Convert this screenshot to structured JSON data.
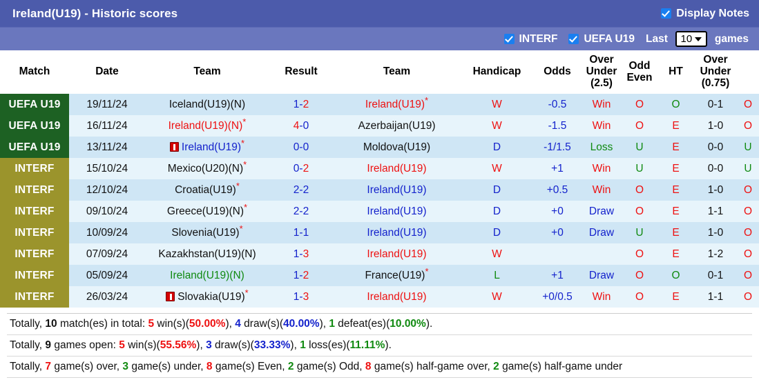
{
  "header": {
    "title": "Ireland(U19) - Historic scores",
    "display_notes_label": "Display Notes",
    "display_notes_checked": true,
    "filters": [
      {
        "label": "INTERF",
        "checked": true
      },
      {
        "label": "UEFA U19",
        "checked": true
      }
    ],
    "last_label": "Last",
    "games_label": "games",
    "games_count": "10"
  },
  "table": {
    "columns": [
      "Match",
      "Date",
      "Team",
      "Result",
      "Team",
      "Handicap",
      "Odds",
      "Over Under (2.5)",
      "Odd Even",
      "HT",
      "Over Under (0.75)"
    ],
    "columns_multiline": {
      "ou25": [
        "Over",
        "Under",
        "(2.5)"
      ],
      "oddeven": [
        "Odd",
        "Even"
      ],
      "ou075": [
        "Over",
        "Under",
        "(0.75)"
      ]
    },
    "rows": [
      {
        "league": "UEFA U19",
        "league_type": "uefa",
        "date": "19/11/24",
        "team1": "Iceland(U19)(N)",
        "team1_color": "black",
        "team1_star": false,
        "team1_card": false,
        "score_home": "1",
        "score_away": "2",
        "score_home_color": "blue",
        "score_away_color": "red",
        "team2": "Ireland(U19)",
        "team2_color": "red",
        "team2_star": true,
        "team2_card": false,
        "result": "W",
        "result_color": "red",
        "handicap": "-0.5",
        "odds": "Win",
        "odds_color": "red",
        "ou25": "O",
        "ou25_color": "red",
        "oddeven": "O",
        "oddeven_color": "green",
        "ht": "0-1",
        "ou075": "O",
        "ou075_color": "red"
      },
      {
        "league": "UEFA U19",
        "league_type": "uefa",
        "date": "16/11/24",
        "team1": "Ireland(U19)(N)",
        "team1_color": "red",
        "team1_star": true,
        "team1_card": false,
        "score_home": "4",
        "score_away": "0",
        "score_home_color": "red",
        "score_away_color": "blue",
        "team2": "Azerbaijan(U19)",
        "team2_color": "black",
        "team2_star": false,
        "team2_card": false,
        "result": "W",
        "result_color": "red",
        "handicap": "-1.5",
        "odds": "Win",
        "odds_color": "red",
        "ou25": "O",
        "ou25_color": "red",
        "oddeven": "E",
        "oddeven_color": "red",
        "ht": "1-0",
        "ou075": "O",
        "ou075_color": "red"
      },
      {
        "league": "UEFA U19",
        "league_type": "uefa",
        "date": "13/11/24",
        "team1": "Ireland(U19)",
        "team1_color": "blue",
        "team1_star": true,
        "team1_card": true,
        "score_home": "0",
        "score_away": "0",
        "score_home_color": "blue",
        "score_away_color": "blue",
        "team2": "Moldova(U19)",
        "team2_color": "black",
        "team2_star": false,
        "team2_card": false,
        "result": "D",
        "result_color": "blue",
        "handicap": "-1/1.5",
        "odds": "Loss",
        "odds_color": "green",
        "ou25": "U",
        "ou25_color": "green",
        "oddeven": "E",
        "oddeven_color": "red",
        "ht": "0-0",
        "ou075": "U",
        "ou075_color": "green"
      },
      {
        "league": "INTERF",
        "league_type": "interf",
        "date": "15/10/24",
        "team1": "Mexico(U20)(N)",
        "team1_color": "black",
        "team1_star": true,
        "team1_card": false,
        "score_home": "0",
        "score_away": "2",
        "score_home_color": "blue",
        "score_away_color": "red",
        "team2": "Ireland(U19)",
        "team2_color": "red",
        "team2_star": false,
        "team2_card": false,
        "result": "W",
        "result_color": "red",
        "handicap": "+1",
        "odds": "Win",
        "odds_color": "red",
        "ou25": "U",
        "ou25_color": "green",
        "oddeven": "E",
        "oddeven_color": "red",
        "ht": "0-0",
        "ou075": "U",
        "ou075_color": "green"
      },
      {
        "league": "INTERF",
        "league_type": "interf",
        "date": "12/10/24",
        "team1": "Croatia(U19)",
        "team1_color": "black",
        "team1_star": true,
        "team1_card": false,
        "score_home": "2",
        "score_away": "2",
        "score_home_color": "blue",
        "score_away_color": "blue",
        "team2": "Ireland(U19)",
        "team2_color": "blue",
        "team2_star": false,
        "team2_card": false,
        "result": "D",
        "result_color": "blue",
        "handicap": "+0.5",
        "odds": "Win",
        "odds_color": "red",
        "ou25": "O",
        "ou25_color": "red",
        "oddeven": "E",
        "oddeven_color": "red",
        "ht": "1-0",
        "ou075": "O",
        "ou075_color": "red"
      },
      {
        "league": "INTERF",
        "league_type": "interf",
        "date": "09/10/24",
        "team1": "Greece(U19)(N)",
        "team1_color": "black",
        "team1_star": true,
        "team1_card": false,
        "score_home": "2",
        "score_away": "2",
        "score_home_color": "blue",
        "score_away_color": "blue",
        "team2": "Ireland(U19)",
        "team2_color": "blue",
        "team2_star": false,
        "team2_card": false,
        "result": "D",
        "result_color": "blue",
        "handicap": "+0",
        "odds": "Draw",
        "odds_color": "blue",
        "ou25": "O",
        "ou25_color": "red",
        "oddeven": "E",
        "oddeven_color": "red",
        "ht": "1-1",
        "ou075": "O",
        "ou075_color": "red"
      },
      {
        "league": "INTERF",
        "league_type": "interf",
        "date": "10/09/24",
        "team1": "Slovenia(U19)",
        "team1_color": "black",
        "team1_star": true,
        "team1_card": false,
        "score_home": "1",
        "score_away": "1",
        "score_home_color": "blue",
        "score_away_color": "blue",
        "team2": "Ireland(U19)",
        "team2_color": "blue",
        "team2_star": false,
        "team2_card": false,
        "result": "D",
        "result_color": "blue",
        "handicap": "+0",
        "odds": "Draw",
        "odds_color": "blue",
        "ou25": "U",
        "ou25_color": "green",
        "oddeven": "E",
        "oddeven_color": "red",
        "ht": "1-0",
        "ou075": "O",
        "ou075_color": "red"
      },
      {
        "league": "INTERF",
        "league_type": "interf",
        "date": "07/09/24",
        "team1": "Kazakhstan(U19)(N)",
        "team1_color": "black",
        "team1_star": false,
        "team1_card": false,
        "score_home": "1",
        "score_away": "3",
        "score_home_color": "blue",
        "score_away_color": "red",
        "team2": "Ireland(U19)",
        "team2_color": "red",
        "team2_star": false,
        "team2_card": false,
        "result": "W",
        "result_color": "red",
        "handicap": "",
        "odds": "",
        "odds_color": "black",
        "ou25": "O",
        "ou25_color": "red",
        "oddeven": "E",
        "oddeven_color": "red",
        "ht": "1-2",
        "ou075": "O",
        "ou075_color": "red"
      },
      {
        "league": "INTERF",
        "league_type": "interf",
        "date": "05/09/24",
        "team1": "Ireland(U19)(N)",
        "team1_color": "green",
        "team1_star": false,
        "team1_card": false,
        "score_home": "1",
        "score_away": "2",
        "score_home_color": "blue",
        "score_away_color": "red",
        "team2": "France(U19)",
        "team2_color": "black",
        "team2_star": true,
        "team2_card": false,
        "result": "L",
        "result_color": "green",
        "handicap": "+1",
        "odds": "Draw",
        "odds_color": "blue",
        "ou25": "O",
        "ou25_color": "red",
        "oddeven": "O",
        "oddeven_color": "green",
        "ht": "0-1",
        "ou075": "O",
        "ou075_color": "red"
      },
      {
        "league": "INTERF",
        "league_type": "interf",
        "date": "26/03/24",
        "team1": "Slovakia(U19)",
        "team1_color": "black",
        "team1_star": true,
        "team1_card": true,
        "score_home": "1",
        "score_away": "3",
        "score_home_color": "blue",
        "score_away_color": "red",
        "team2": "Ireland(U19)",
        "team2_color": "red",
        "team2_star": false,
        "team2_card": false,
        "result": "W",
        "result_color": "red",
        "handicap": "+0/0.5",
        "odds": "Win",
        "odds_color": "red",
        "ou25": "O",
        "ou25_color": "red",
        "oddeven": "E",
        "oddeven_color": "red",
        "ht": "1-1",
        "ou075": "O",
        "ou075_color": "red"
      }
    ]
  },
  "summary": {
    "line1": {
      "prefix": "Totally, ",
      "total": "10",
      "mid1": " match(es) in total: ",
      "wins": "5",
      "wins_text": " win(s)(",
      "wins_pct": "50.00%",
      "close1": "), ",
      "draws": "4",
      "draws_text": " draw(s)(",
      "draws_pct": "40.00%",
      "close2": "), ",
      "defeats": "1",
      "defeats_text": " defeat(es)(",
      "defeats_pct": "10.00%",
      "close3": ")."
    },
    "line2": {
      "prefix": "Totally, ",
      "total": "9",
      "mid1": " games open: ",
      "wins": "5",
      "wins_text": " win(s)(",
      "wins_pct": "55.56%",
      "close1": "), ",
      "draws": "3",
      "draws_text": " draw(s)(",
      "draws_pct": "33.33%",
      "close2": "), ",
      "losses": "1",
      "losses_text": " loss(es)(",
      "losses_pct": "11.11%",
      "close3": ")."
    },
    "line3": {
      "prefix": "Totally, ",
      "over": "7",
      "over_text": " game(s) over, ",
      "under": "3",
      "under_text": " game(s) under, ",
      "even": "8",
      "even_text": " game(s) Even, ",
      "odd": "2",
      "odd_text": " game(s) Odd, ",
      "half_over": "8",
      "half_over_text": " game(s) half-game over, ",
      "half_under": "2",
      "half_under_text": " game(s) half-game under"
    }
  },
  "colors": {
    "titlebar": "#4c5bab",
    "subbar": "#6a77be",
    "uefa_badge": "#1d6123",
    "interf_badge": "#9b942c",
    "row_even": "#cfe6f5",
    "row_odd": "#e7f4fb",
    "red": "#ee1111",
    "blue": "#1422cc",
    "green": "#108a10",
    "checkbox": "#1a7ff0"
  }
}
